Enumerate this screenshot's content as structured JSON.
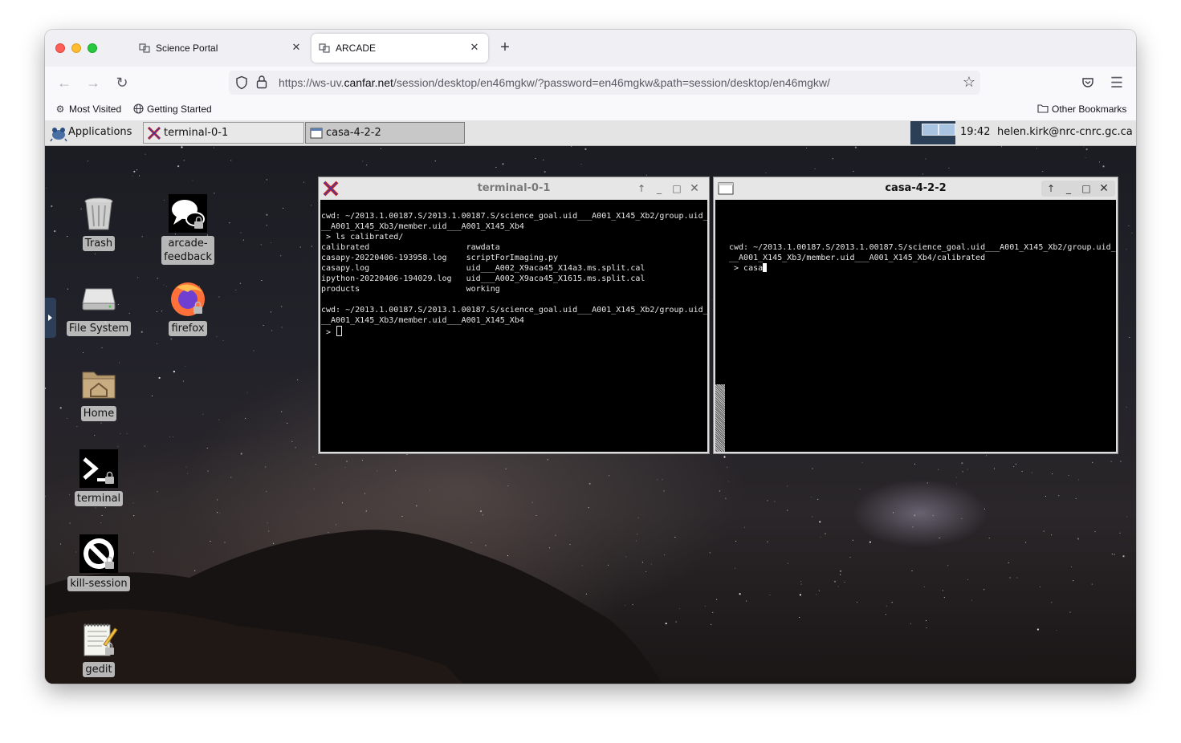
{
  "browser": {
    "tabs": [
      {
        "label": "Science Portal",
        "active": false
      },
      {
        "label": "ARCADE",
        "active": true
      }
    ],
    "new_tab_label": "+",
    "url_prefix": "https://ws-uv.",
    "url_host": "canfar.net",
    "url_path": "/session/desktop/en46mgkw/?password=en46mgkw&path=session/desktop/en46mgkw/",
    "bookmarks": [
      {
        "label": "Most Visited",
        "icon": "gear-icon"
      },
      {
        "label": "Getting Started",
        "icon": "globe-icon"
      }
    ],
    "other_bookmarks": "Other Bookmarks"
  },
  "panel": {
    "applications_label": "Applications",
    "tasks": [
      {
        "label": "terminal-0-1",
        "pressed": false
      },
      {
        "label": "casa-4-2-2",
        "pressed": true
      }
    ],
    "clock": "19:42",
    "user": "helen.kirk@nrc-cnrc.gc.ca"
  },
  "desktop_icons": [
    {
      "label": "Trash",
      "icon": "trash-icon"
    },
    {
      "label": "arcade-\nfeedback",
      "icon": "chat-bubbles-icon"
    },
    {
      "label": "File System",
      "icon": "hard-drive-icon"
    },
    {
      "label": "firefox",
      "icon": "firefox-icon"
    },
    {
      "label": "Home",
      "icon": "home-folder-icon"
    },
    {
      "label": "terminal",
      "icon": "terminal-icon"
    },
    {
      "label": "kill-session",
      "icon": "prohibit-icon"
    },
    {
      "label": "gedit",
      "icon": "text-editor-icon"
    }
  ],
  "terminal_window": {
    "title": "terminal-0-1",
    "lines": [
      "cwd: ~/2013.1.00187.S/2013.1.00187.S/science_goal.uid___A001_X145_Xb2/group.uid_",
      "__A001_X145_Xb3/member.uid___A001_X145_Xb4",
      " > ls calibrated/",
      "calibrated                    rawdata",
      "casapy-20220406-193958.log    scriptForImaging.py",
      "casapy.log                    uid___A002_X9aca45_X14a3.ms.split.cal",
      "ipython-20220406-194029.log   uid___A002_X9aca45_X1615.ms.split.cal",
      "products                      working",
      "",
      "cwd: ~/2013.1.00187.S/2013.1.00187.S/science_goal.uid___A001_X145_Xb2/group.uid_",
      "__A001_X145_Xb3/member.uid___A001_X145_Xb4"
    ],
    "prompt": " > "
  },
  "casa_window": {
    "title": "casa-4-2-2",
    "lines": [
      "cwd: ~/2013.1.00187.S/2013.1.00187.S/science_goal.uid___A001_X145_Xb2/group.uid_",
      "__A001_X145_Xb3/member.uid___A001_X145_Xb4/calibrated"
    ],
    "prompt": " > casa"
  },
  "colors": {
    "panel_bg": "#e4e4e4",
    "terminal_bg": "#000000",
    "terminal_fg": "#e8e8e8",
    "traffic_red": "#fe5f57",
    "traffic_yellow": "#febc2e",
    "traffic_green": "#28c840"
  }
}
